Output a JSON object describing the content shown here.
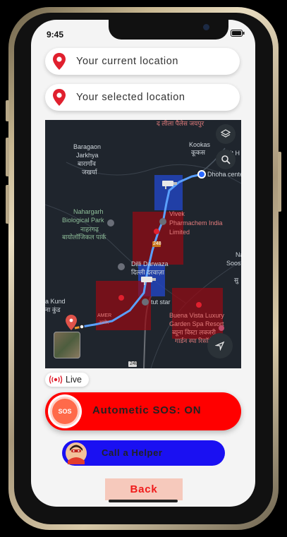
{
  "status": {
    "time": "9:45"
  },
  "locations": {
    "current_label": "Your current location",
    "selected_label": "Your selected location"
  },
  "map": {
    "labels": {
      "lila_palace": "द लीला पैलेस जयपुर",
      "kookas": "Kookas",
      "kookas_hi": "कूकस",
      "baragaon": "Baragaon",
      "jarkhya": "Jarkhya",
      "baragaon_hi": "बारागाँव",
      "jarkhya_hi": "जखर्या",
      "dhoha_center": "Dhoha center",
      "nahargarh": "Nahargarh",
      "biological_park": "Biological Park",
      "nahargarh_hi": "नाहरगढ़",
      "biological_park_hi": "बायोलॉजिकल पार्क",
      "vivek": "Vivek",
      "pharmachem": "Pharmachem India",
      "limited": "Limited",
      "road_248": "248",
      "dilli_darwaza": "Dilli Darwaza",
      "dilli_darwaza_hi": "दिल्ली दरवाज़ा",
      "na": "Na",
      "soos": "Soos",
      "su": "सु",
      "kund": "a Kund",
      "kund_hi": "ना कुंड",
      "amer": "AMER",
      "amer_hi": "आमेर",
      "tut_star": "tut star",
      "buena_vista": "Buena Vista Luxury",
      "garden_spa": "Garden Spa Resort",
      "buena_vista_hi": "ब्यूना विस्टा लक्जरी",
      "garden_spa_hi": "गार्डन स्पा रिसॉर्ट",
      "road_248b": "248",
      "cit": "Cit H"
    }
  },
  "live": {
    "label": "Live"
  },
  "sos": {
    "badge": "SOS",
    "label": "Autometic SOS: ON"
  },
  "helper": {
    "label": "Call a Helper"
  },
  "back": {
    "label": "Back"
  },
  "colors": {
    "accent_red": "#ff0000",
    "helper_blue": "#1a10f2",
    "back_bg": "#f6c9bc",
    "back_text": "#f01a1a",
    "pin_red": "#e0202e"
  },
  "icons": {
    "location_pin": "location-pin-icon",
    "layers": "layers-icon",
    "search": "search-icon",
    "navigate": "navigate-arrow-icon",
    "live": "live-broadcast-icon",
    "sos": "sos-icon",
    "helper": "helper-avatar-icon",
    "signal": "signal-icon",
    "wifi": "wifi-icon",
    "battery": "battery-icon"
  }
}
